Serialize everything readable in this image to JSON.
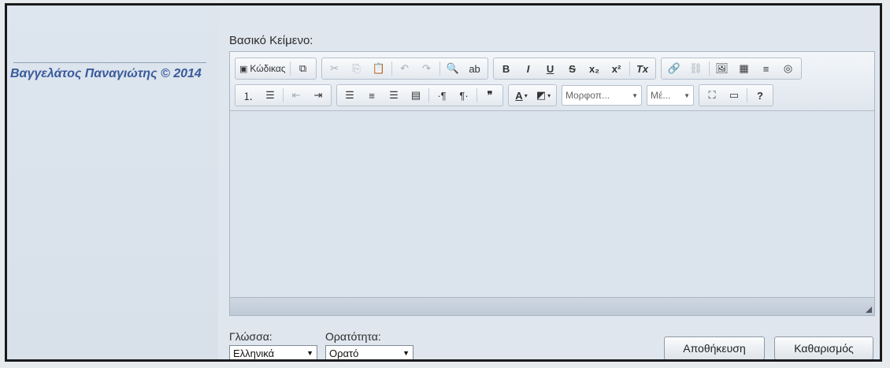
{
  "author": "Βαγγελάτος Παναγιώτης © 2014",
  "editor": {
    "label": "Βασικό Κείμενο:",
    "toolbar_row1": {
      "source_label": "Κώδικας",
      "bold": "B",
      "italic": "I",
      "underline": "U",
      "strike": "S",
      "subscript": "x₂",
      "superscript": "x²",
      "removeformat": "Tx"
    },
    "toolbar_row2": {
      "format_label": "Μορφοπ...",
      "size_label": "Μέ...",
      "help_label": "?"
    }
  },
  "language": {
    "label": "Γλώσσα:",
    "value": "Ελληνικά"
  },
  "visibility": {
    "label": "Ορατότητα:",
    "value": "Ορατό"
  },
  "buttons": {
    "save": "Αποθήκευση",
    "clear": "Καθαρισμός"
  }
}
